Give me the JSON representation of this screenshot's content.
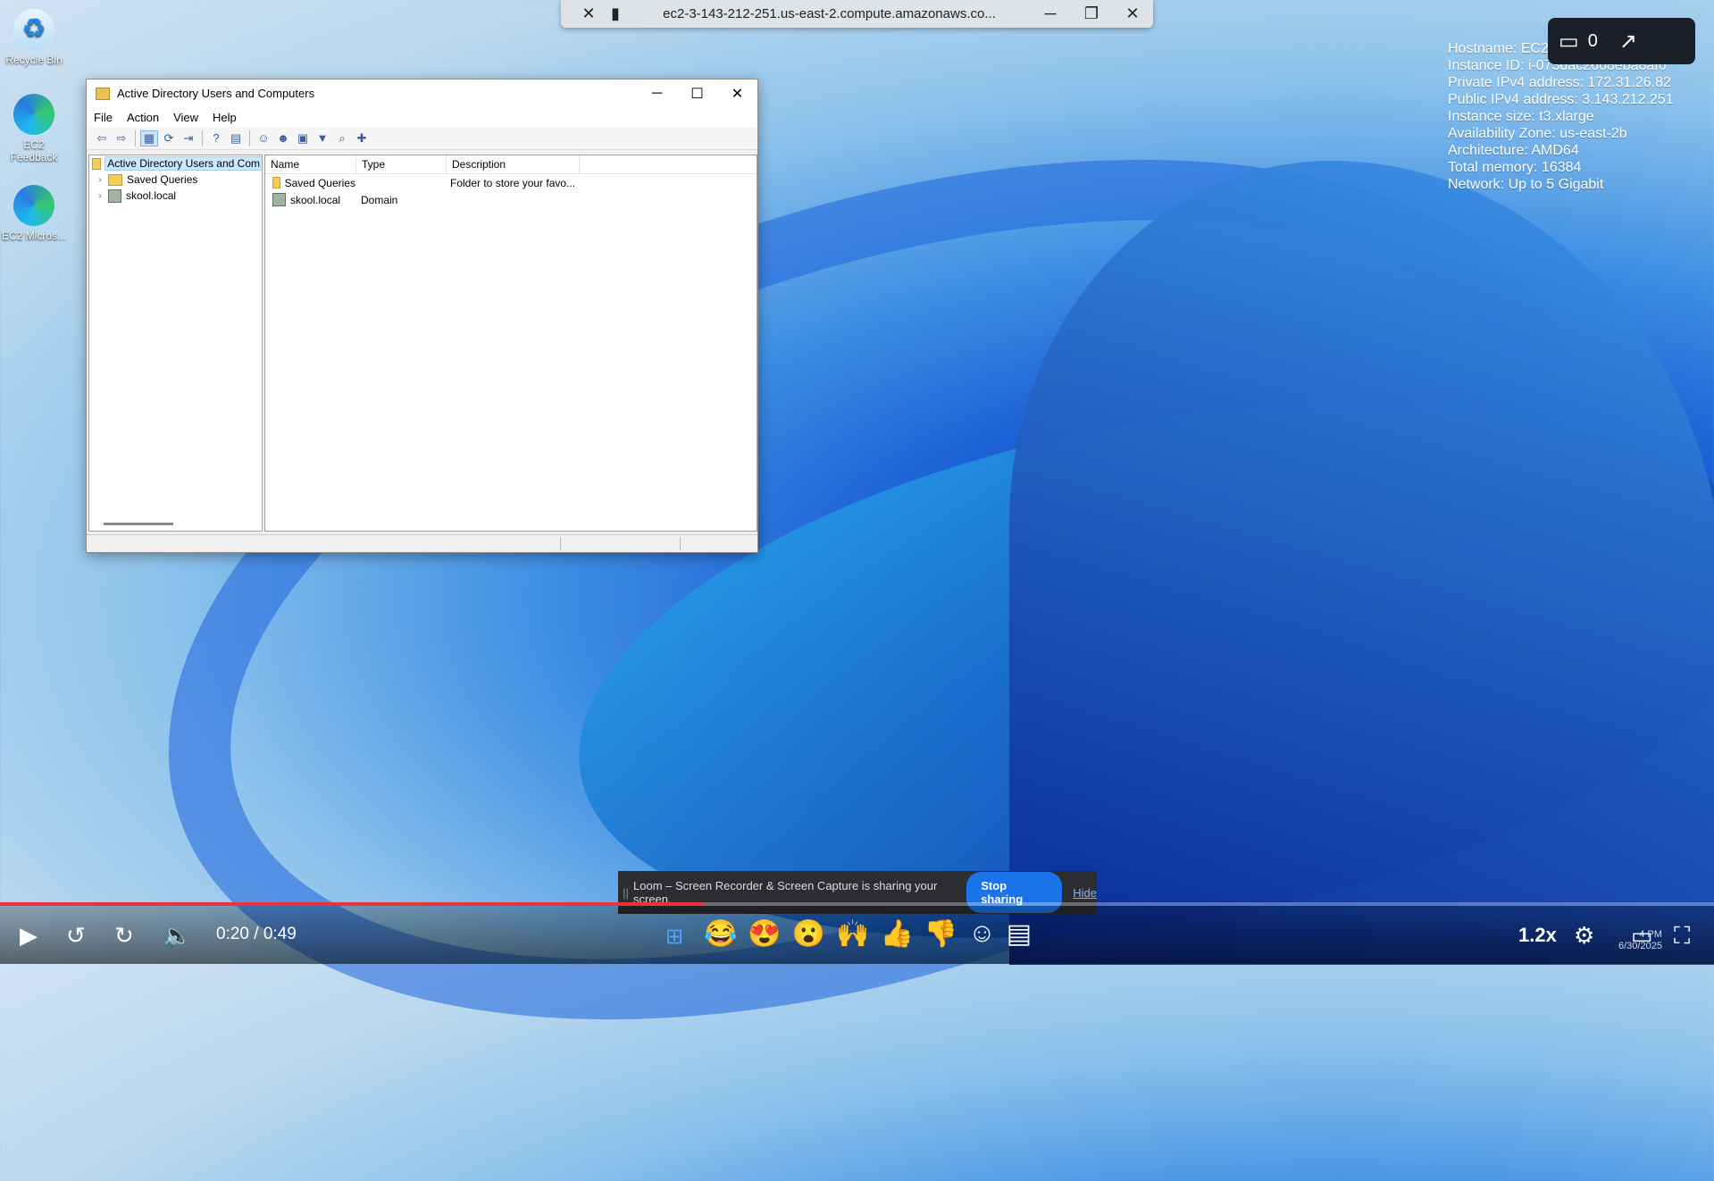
{
  "desktop": {
    "icons": [
      {
        "label": "Recycle Bin",
        "icon": "recycle-bin-icon"
      },
      {
        "label": "EC2 Feedback",
        "icon": "edge-icon"
      },
      {
        "label": "EC2 Micros...",
        "icon": "edge-icon"
      }
    ]
  },
  "rdp_bar": {
    "title": "ec2-3-143-212-251.us-east-2.compute.amazonaws.co...",
    "minimize": "─",
    "restore": "❐",
    "close": "✕"
  },
  "sysinfo": [
    "Hostname: EC2A",
    "Instance ID: i-073dac2668eba8af6",
    "Private IPv4 address: 172.31.26.82",
    "Public IPv4 address: 3.143.212.251",
    "Instance size: t3.xlarge",
    "Availability Zone: us-east-2b",
    "Architecture: AMD64",
    "Total memory: 16384",
    "Network: Up to 5 Gigabit"
  ],
  "loom_pill": {
    "comments_count": "0"
  },
  "window": {
    "title": "Active Directory Users and Computers",
    "menu": [
      "File",
      "Action",
      "View",
      "Help"
    ],
    "tree": {
      "root": "Active Directory Users and Com",
      "items": [
        "Saved Queries",
        "skool.local"
      ]
    },
    "list": {
      "columns": [
        "Name",
        "Type",
        "Description"
      ],
      "rows": [
        {
          "name": "Saved Queries",
          "type": "",
          "description": "Folder to store your favo..."
        },
        {
          "name": "skool.local",
          "type": "Domain",
          "description": ""
        }
      ]
    }
  },
  "loom_banner": {
    "message": "Loom – Screen Recorder & Screen Capture is sharing your screen.",
    "stop": "Stop sharing",
    "hide": "Hide"
  },
  "player": {
    "time": "0:20 / 0:49",
    "progress": 0.41,
    "speed": "1.2x",
    "reactions": [
      "😂",
      "😍",
      "😮",
      "🙌",
      "👍",
      "👎"
    ],
    "clock_time": "4 PM",
    "clock_date": "6/30/2025"
  },
  "colors": {
    "accent": "#1a73e8",
    "progress": "#e8323c"
  }
}
